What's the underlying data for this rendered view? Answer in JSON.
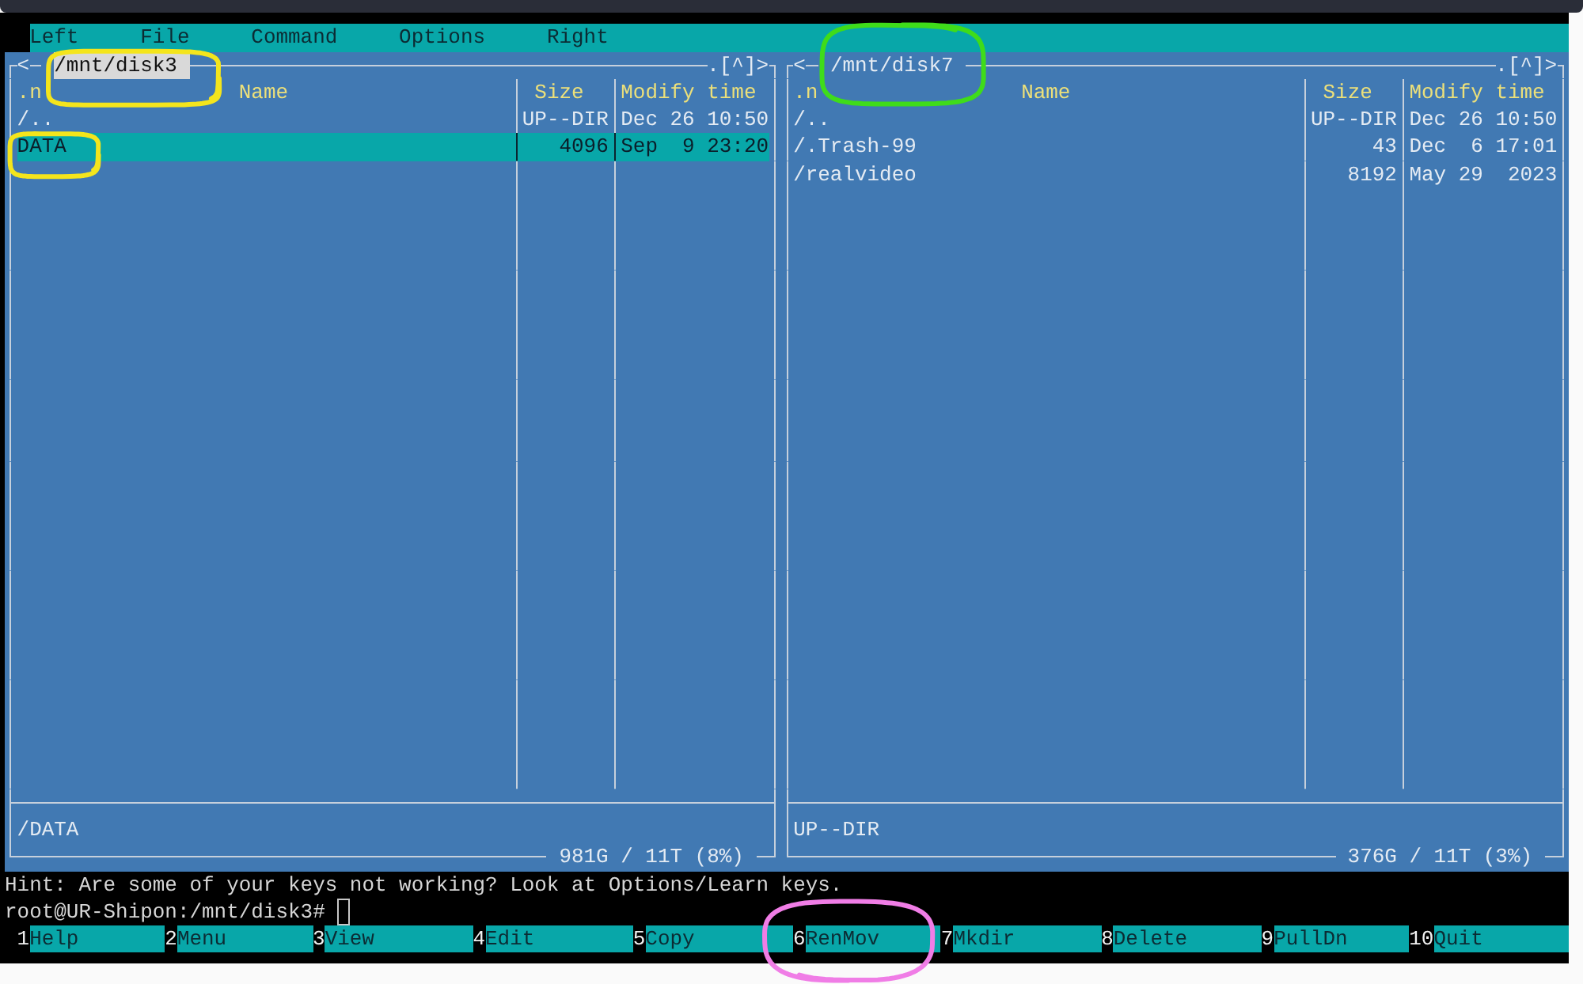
{
  "menu_bar": {
    "items": [
      "Left",
      "File",
      "Command",
      "Options",
      "Right"
    ]
  },
  "panels": [
    {
      "active": true,
      "back": "<",
      "path": "/mnt/disk3",
      "controls": ".[^]>",
      "sort_mark": ".n",
      "columns": [
        "Name",
        "Size",
        "Modify time"
      ],
      "files": [
        {
          "name": "/..",
          "size": "UP--DIR",
          "modified": "Dec 26 10:50",
          "selected": false
        },
        {
          "name": "DATA",
          "size": "4096",
          "modified": "Sep  9 23:20",
          "selected": true
        }
      ],
      "mini_status": "/DATA",
      "disk_info": "981G / 11T (8%)"
    },
    {
      "active": false,
      "back": "<",
      "path": "/mnt/disk7",
      "controls": ".[^]>",
      "sort_mark": ".n",
      "columns": [
        "Name",
        "Size",
        "Modify time"
      ],
      "files": [
        {
          "name": "/..",
          "size": "UP--DIR",
          "modified": "Dec 26 10:50",
          "selected": false
        },
        {
          "name": "/.Trash-99",
          "size": "43",
          "modified": "Dec  6 17:01",
          "selected": false
        },
        {
          "name": "/realvideo",
          "size": "8192",
          "modified": "May 29  2023",
          "selected": false
        }
      ],
      "mini_status": "UP--DIR",
      "disk_info": "376G / 11T (3%)"
    }
  ],
  "hint": "Hint: Are some of your keys not working? Look at Options/Learn keys.",
  "command_line": {
    "prompt": "root@UR-Shipon:/mnt/disk3#"
  },
  "function_keys": [
    {
      "key": "1",
      "label": "Help"
    },
    {
      "key": "2",
      "label": "Menu"
    },
    {
      "key": "3",
      "label": "View"
    },
    {
      "key": "4",
      "label": "Edit"
    },
    {
      "key": "5",
      "label": "Copy"
    },
    {
      "key": "6",
      "label": "RenMov"
    },
    {
      "key": "7",
      "label": "Mkdir"
    },
    {
      "key": "8",
      "label": "Delete"
    },
    {
      "key": "9",
      "label": "PullDn"
    },
    {
      "key": "10",
      "label": "Quit"
    }
  ],
  "annotations": [
    {
      "color": "#f4e51c"
    },
    {
      "color": "#f4e51c"
    },
    {
      "color": "#3fdc1a"
    },
    {
      "color": "#f07de6"
    }
  ]
}
